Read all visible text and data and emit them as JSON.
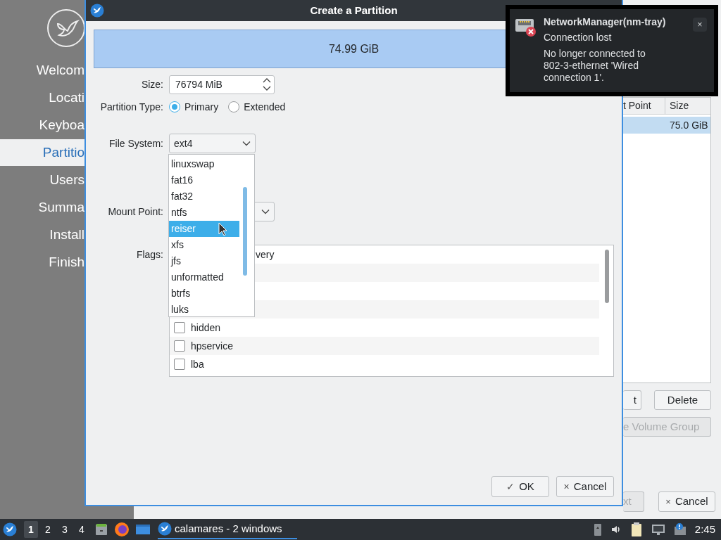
{
  "sidebar": {
    "items": [
      {
        "label": "Welcom",
        "selected": false
      },
      {
        "label": "Locati",
        "selected": false
      },
      {
        "label": "Keyboa",
        "selected": false
      },
      {
        "label": "Partitio",
        "selected": true
      },
      {
        "label": "Users",
        "selected": false
      },
      {
        "label": "Summa",
        "selected": false
      },
      {
        "label": "Install",
        "selected": false
      },
      {
        "label": "Finish",
        "selected": false
      }
    ]
  },
  "main": {
    "table": {
      "columns": [
        "t Point",
        "Size"
      ],
      "rows": [
        {
          "size": "75.0 GiB",
          "selected": true
        }
      ]
    },
    "buttons": [
      {
        "label": "t",
        "disabled": false
      },
      {
        "label": "Delete",
        "disabled": false
      },
      {
        "label": "e Volume Group",
        "disabled": true
      }
    ],
    "nav_buttons": [
      {
        "label": "xt",
        "disabled": true
      },
      {
        "icon": "×",
        "label": "Cancel",
        "disabled": false
      }
    ]
  },
  "dialog": {
    "title": "Create a Partition",
    "capacity": "74.99 GiB",
    "size": {
      "label": "Size:",
      "value": "76794 MiB"
    },
    "partition_type": {
      "label": "Partition Type:",
      "options": [
        {
          "label": "Primary",
          "selected": true
        },
        {
          "label": "Extended",
          "selected": false
        }
      ]
    },
    "file_system": {
      "label": "File System:",
      "value": "ext4",
      "options": [
        {
          "label": "linuxswap",
          "selected": false
        },
        {
          "label": "fat16",
          "selected": false
        },
        {
          "label": "fat32",
          "selected": false
        },
        {
          "label": "ntfs",
          "selected": false
        },
        {
          "label": "reiser",
          "selected": true
        },
        {
          "label": "xfs",
          "selected": false
        },
        {
          "label": "jfs",
          "selected": false
        },
        {
          "label": "unformatted",
          "selected": false
        },
        {
          "label": "btrfs",
          "selected": false
        },
        {
          "label": "luks",
          "selected": false
        }
      ]
    },
    "mount_point": {
      "label": "Mount Point:"
    },
    "flags": {
      "label": "Flags:",
      "items": [
        {
          "label": "very"
        },
        {
          "label": "hidden",
          "checked": false
        },
        {
          "label": "hpservice",
          "checked": false
        },
        {
          "label": "lba",
          "checked": false
        }
      ]
    },
    "buttons": [
      {
        "icon": "✓",
        "label": "OK"
      },
      {
        "icon": "×",
        "label": "Cancel"
      }
    ]
  },
  "notification": {
    "app": "NetworkManager(nm-tray)",
    "summary": "Connection lost",
    "body": "No longer connected to 802-3-ethernet 'Wired connection 1'.",
    "close": "×"
  },
  "taskbar": {
    "workspaces": [
      {
        "label": "1",
        "selected": true
      },
      {
        "label": "2",
        "selected": false
      },
      {
        "label": "3",
        "selected": false
      },
      {
        "label": "4",
        "selected": false
      }
    ],
    "task": "calamares - 2 windows",
    "clock": "2:45"
  }
}
